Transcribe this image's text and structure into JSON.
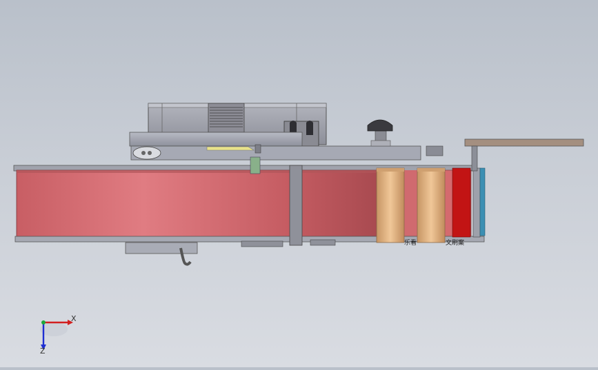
{
  "view": {
    "axes": {
      "x_label": "X",
      "z_label": "Z"
    },
    "annotations": {
      "left_roller_text": "乐看",
      "right_roller_text": "文刷案"
    },
    "colors": {
      "belt": "#d46a6e",
      "belt_dark": "#a8474c",
      "housing": "#9a9ca8",
      "roller": "#e6b98a",
      "accent_red": "#c21414",
      "accent_blue": "#3c8fb3",
      "arm": "#a48f80",
      "x_axis": "#d21f1f",
      "y_axis": "#1fa83a",
      "z_axis": "#1f2fd2"
    }
  }
}
